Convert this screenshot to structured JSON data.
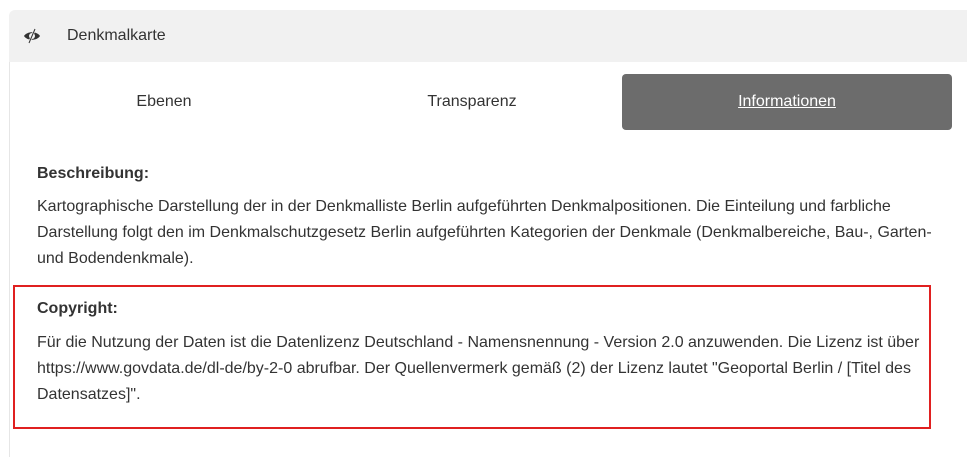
{
  "header": {
    "icon": "eye-slash-icon",
    "title": "Denkmalkarte"
  },
  "tabs": [
    {
      "label": "Ebenen",
      "active": false
    },
    {
      "label": "Transparenz",
      "active": false
    },
    {
      "label": "Informationen",
      "active": true
    }
  ],
  "description": {
    "heading": "Beschreibung:",
    "text": "Kartographische Darstellung der in der Denkmalliste Berlin aufgeführten Denkmalpositionen. Die Einteilung und farbliche Darstellung folgt den im Denkmalschutzgesetz Berlin aufgeführten Kategorien der Denkmale (Denkmalbereiche, Bau-, Garten- und Bodendenkmale)."
  },
  "copyright": {
    "heading": "Copyright:",
    "text": "Für die Nutzung der Daten ist die Datenlizenz Deutschland - Namensnennung - Version 2.0 anzuwenden. Die Lizenz ist über https://www.govdata.de/dl-de/by-2-0 abrufbar. Der Quellenvermerk gemäß (2) der Lizenz lautet \"Geoportal Berlin / [Titel des Datensatzes]\".",
    "highlight_color": "#e02020"
  },
  "colors": {
    "header_bg": "#f1f1f1",
    "active_tab_bg": "#6c6c6c",
    "text": "#333333"
  }
}
